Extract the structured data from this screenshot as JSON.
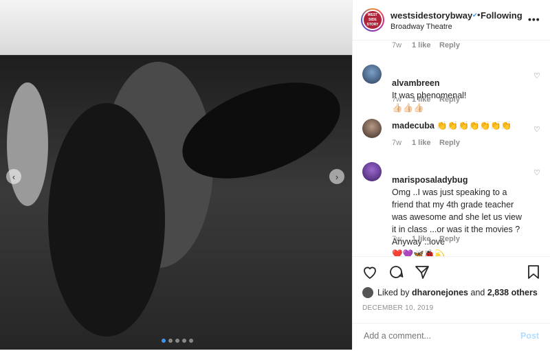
{
  "post": {
    "photo_alt_icon": "dance-photo",
    "carousel": {
      "total": 5,
      "active": 0
    }
  },
  "header": {
    "username": "westsidestorybway",
    "verified_icon": "verified-badge-icon",
    "separator": "•",
    "follow_state": "Following",
    "location": "Broadway Theatre",
    "avatar_text": "WEST SIDE STORY",
    "more_icon": "more-options-icon"
  },
  "comments": [
    {
      "user": "",
      "text": "",
      "meta": {
        "time": "7w",
        "likes": "1 like",
        "reply": "Reply"
      }
    },
    {
      "user": "alvambreen",
      "text": "It was phenomenal!\n👍🏻👍🏻👍🏻",
      "meta": {
        "time": "7w",
        "likes": "1 like",
        "reply": "Reply"
      }
    },
    {
      "user": "madecuba",
      "text": "👏👏👏👏👏👏👏",
      "meta": {
        "time": "7w",
        "likes": "1 like",
        "reply": "Reply"
      }
    },
    {
      "user": "marisposaladybug",
      "text": "Omg ..I was just speaking to a friend that my 4th grade teacher was awesome and she let us view it in class ...or was it the movies ? Anyway ..love\n❤️💜🦋🐞💫",
      "meta": {
        "time": "7w",
        "likes": "1 like",
        "reply": "Reply"
      }
    }
  ],
  "actions": {
    "like_icon": "heart-icon",
    "comment_icon": "comment-icon",
    "share_icon": "share-icon",
    "save_icon": "bookmark-icon"
  },
  "likes": {
    "prefix": "Liked by",
    "user": "dharonejones",
    "and": "and",
    "count": "2,838 others"
  },
  "date": "DECEMBER 10, 2019",
  "composer": {
    "placeholder": "Add a comment...",
    "post_label": "Post"
  },
  "colors": {
    "accent": "#3897f0",
    "post_disabled": "#b3dbff",
    "muted": "#8e8e8e"
  }
}
